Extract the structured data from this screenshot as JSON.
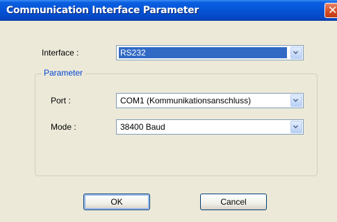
{
  "window": {
    "title": "Communication Interface Parameter",
    "close_symbol": "✕"
  },
  "interface": {
    "label": "Interface :",
    "value": "RS232"
  },
  "parameter_group": {
    "title": "Parameter",
    "port": {
      "label": "Port :",
      "value": "COM1 (Kommunikationsanschluss)"
    },
    "mode": {
      "label": "Mode :",
      "value": "38400 Baud"
    }
  },
  "buttons": {
    "ok": "OK",
    "cancel": "Cancel"
  },
  "colors": {
    "title_bar": "#0553D6",
    "accent_blue": "#316AC5",
    "group_title": "#0046D5",
    "close": "#D24A1F"
  }
}
